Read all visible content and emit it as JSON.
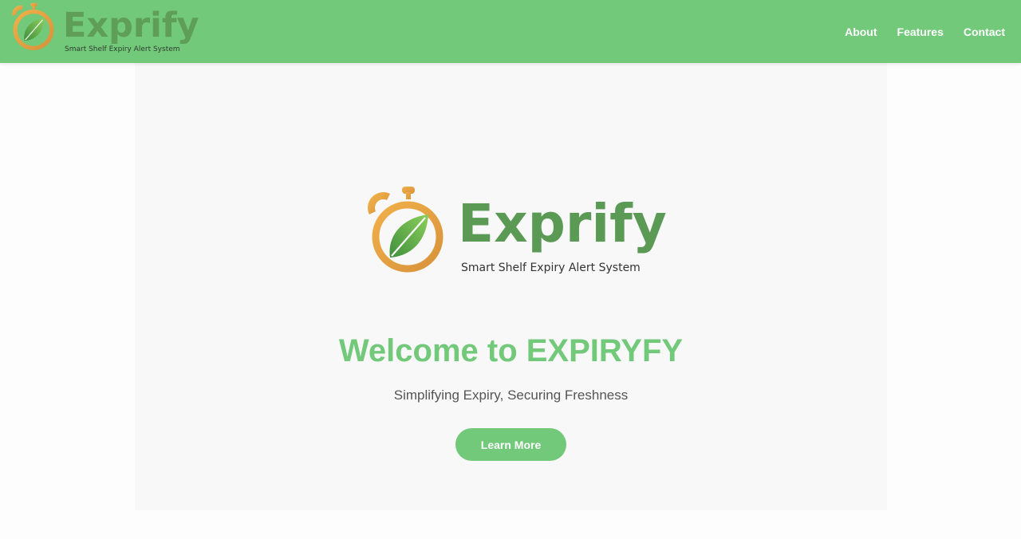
{
  "brand": {
    "name": "Exprify",
    "tagline": "Smart Shelf Expiry Alert System"
  },
  "nav": {
    "items": [
      {
        "label": "About"
      },
      {
        "label": "Features"
      },
      {
        "label": "Contact"
      }
    ]
  },
  "hero": {
    "title": "Welcome to EXPIRYFY",
    "subtitle": "Simplifying Expiry, Securing Freshness",
    "button_label": "Learn More"
  },
  "colors": {
    "header_bg": "#72c97a",
    "accent_green": "#72c97a",
    "brand_green": "#5a9a55",
    "clock_orange": "#e3a043",
    "hero_bg": "#f9f8f9"
  },
  "icons": {
    "logo": "stopwatch-leaf-icon"
  }
}
